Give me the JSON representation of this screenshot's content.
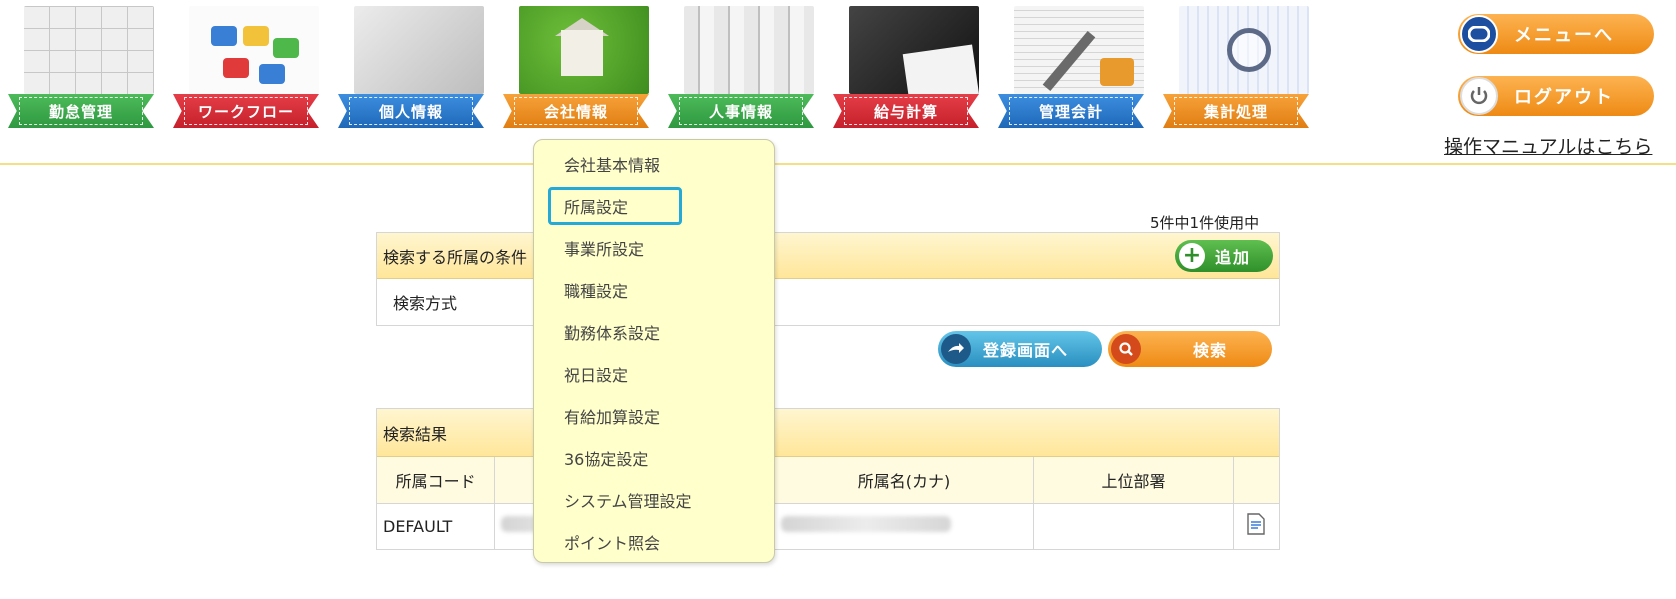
{
  "nav": {
    "items": [
      {
        "label": "勤怠管理",
        "color": "#3aa84a"
      },
      {
        "label": "ワークフロー",
        "color": "#d42b36"
      },
      {
        "label": "個人情報",
        "color": "#2a7bd0"
      },
      {
        "label": "会社情報",
        "color": "#ee8a14"
      },
      {
        "label": "人事情報",
        "color": "#3aa84a"
      },
      {
        "label": "給与計算",
        "color": "#d42b36"
      },
      {
        "label": "管理会計",
        "color": "#2a7bd0"
      },
      {
        "label": "集計処理",
        "color": "#ee8a14"
      }
    ]
  },
  "header_buttons": {
    "menu_label": "メニューへ",
    "logout_label": "ログアウト",
    "manual_link": "操作マニュアルはこちら"
  },
  "search": {
    "count_text": "5件中1件使用中",
    "panel_title": "検索する所属の条件",
    "add_label": "追加",
    "method_label": "検索方式",
    "register_label": "登録画面へ",
    "search_label": "検索"
  },
  "results": {
    "title": "検索結果",
    "columns": [
      "所属コード",
      "",
      "所属名(カナ)",
      "上位部署",
      ""
    ],
    "rows": [
      {
        "code": "DEFAULT",
        "name": "",
        "kana": "",
        "parent": ""
      }
    ]
  },
  "dropdown": {
    "items": [
      "会社基本情報",
      "所属設定",
      "事業所設定",
      "職種設定",
      "勤務体系設定",
      "祝日設定",
      "有給加算設定",
      "36協定設定",
      "システム管理設定",
      "ポイント照会"
    ],
    "highlighted_index": 1
  },
  "colors": {
    "header_border": "#f3df86",
    "panel_header": "#ffe699",
    "dropdown_bg": "#ffffcc",
    "highlight": "#25a9d6",
    "orange": "#ee8a14"
  }
}
